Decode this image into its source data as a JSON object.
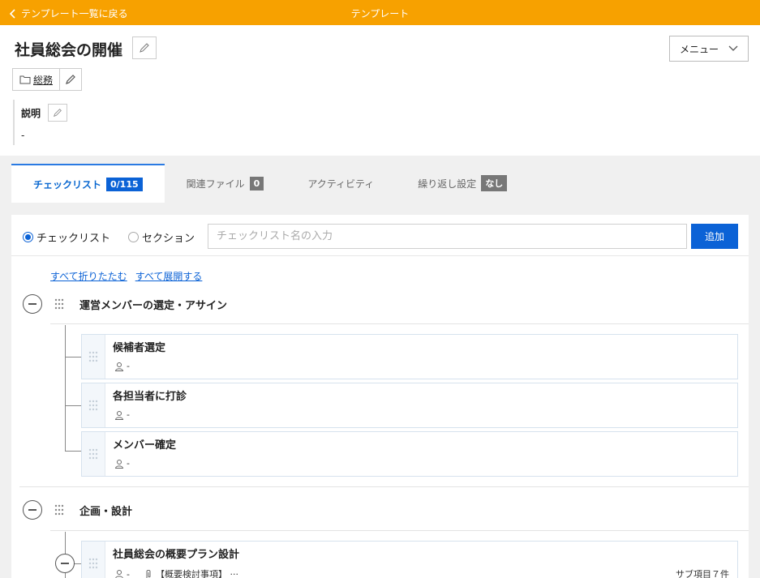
{
  "topbar": {
    "back_label": "テンプレート一覧に戻る",
    "title": "テンプレート",
    "color": "#f7a100"
  },
  "header": {
    "page_title": "社員総会の開催",
    "menu_label": "メニュー",
    "category": "総務",
    "description_label": "説明",
    "description_value": "-"
  },
  "tabs": [
    {
      "label": "チェックリスト",
      "badge": "0/115",
      "active": true
    },
    {
      "label": "関連ファイル",
      "badge": "0"
    },
    {
      "label": "アクティビティ",
      "badge": ""
    },
    {
      "label": "繰り返し設定",
      "badge": "なし"
    }
  ],
  "add_form": {
    "radio_checklist": "チェックリスト",
    "radio_section": "セクション",
    "selected": "チェックリスト",
    "input_placeholder": "チェックリスト名の入力",
    "add_label": "追加"
  },
  "fold_links": {
    "collapse_all": "すべて折りたたむ",
    "expand_all": "すべて展開する"
  },
  "sections": [
    {
      "title": "運営メンバーの選定・アサイン",
      "items": [
        {
          "title": "候補者選定",
          "assignee": "-"
        },
        {
          "title": "各担当者に打診",
          "assignee": "-"
        },
        {
          "title": "メンバー確定",
          "assignee": "-"
        }
      ]
    },
    {
      "title": "企画・設計",
      "items": [
        {
          "title": "社員総会の概要プラン設計",
          "assignee": "-",
          "file": "【概要検討事項】 ···",
          "subitems": "サブ項目７件"
        }
      ]
    }
  ],
  "accent_color": "#0b62d6"
}
